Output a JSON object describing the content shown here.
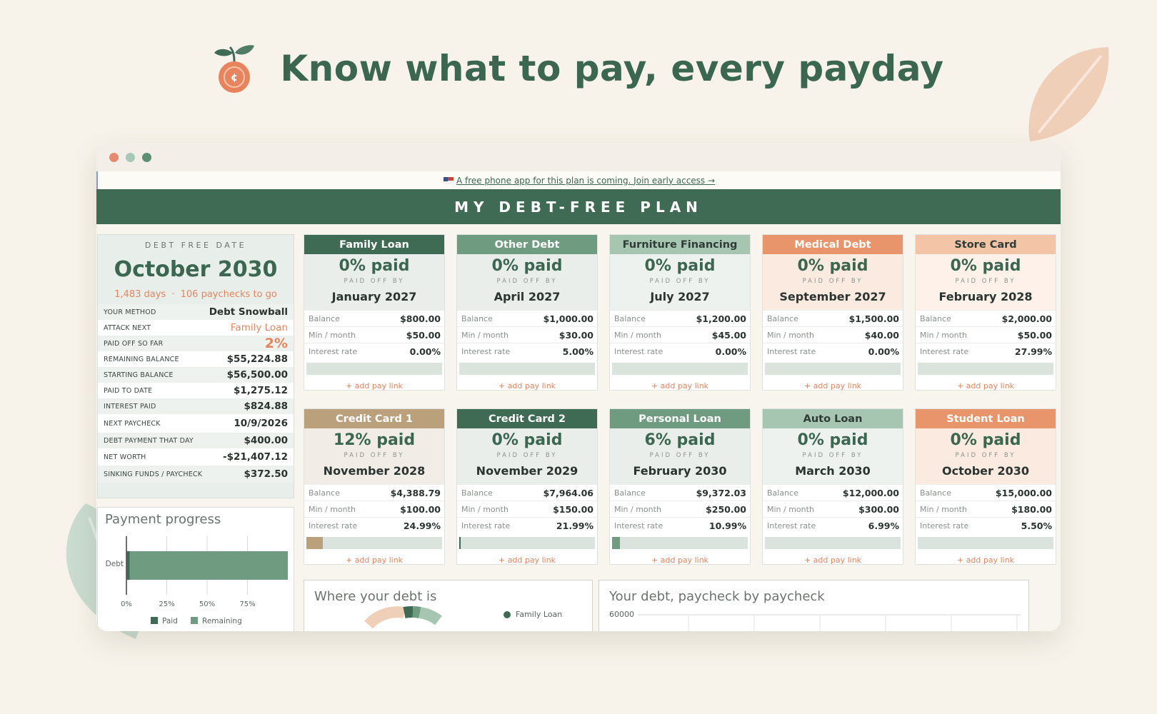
{
  "hero": {
    "title": "Know what to pay, every payday"
  },
  "banner": {
    "text": "A free phone app for this plan is coming. Join early access →"
  },
  "plan": {
    "title": "MY DEBT-FREE PLAN"
  },
  "summary": {
    "label": "DEBT FREE DATE",
    "date": "October 2030",
    "days": "1,483 days",
    "separator": "·",
    "paychecks": "106 paychecks to go",
    "rows": [
      {
        "key": "YOUR METHOD",
        "value": "Debt Snowball"
      },
      {
        "key": "ATTACK NEXT",
        "value": "Family Loan"
      },
      {
        "key": "PAID OFF SO FAR",
        "value": "2%"
      },
      {
        "key": "REMAINING BALANCE",
        "value": "$55,224.88"
      },
      {
        "key": "STARTING BALANCE",
        "value": "$56,500.00"
      },
      {
        "key": "PAID TO DATE",
        "value": "$1,275.12"
      },
      {
        "key": "INTEREST PAID",
        "value": "$824.88"
      },
      {
        "key": "NEXT PAYCHECK",
        "value": "10/9/2026"
      },
      {
        "key": "DEBT PAYMENT THAT DAY",
        "value": "$400.00"
      },
      {
        "key": "NET WORTH",
        "value": "-$21,407.12"
      },
      {
        "key": "SINKING FUNDS / PAYCHECK",
        "value": "$372.50"
      }
    ]
  },
  "labels": {
    "paid_off_by": "PAID OFF BY",
    "balance": "Balance",
    "min_month": "Min / month",
    "interest_rate": "Interest rate",
    "add_pay_link": "+ add pay link"
  },
  "debts": [
    {
      "name": "Family Loan",
      "paid": "0% paid",
      "paid_fraction": 0.0,
      "paid_off_by": "January 2027",
      "balance": "$800.00",
      "min": "$50.00",
      "rate": "0.00%",
      "color": "#3f6b55",
      "tint": "#e9eeea"
    },
    {
      "name": "Other Debt",
      "paid": "0% paid",
      "paid_fraction": 0.0,
      "paid_off_by": "April 2027",
      "balance": "$1,000.00",
      "min": "$30.00",
      "rate": "5.00%",
      "color": "#6f9b80",
      "tint": "#e9eeea"
    },
    {
      "name": "Furniture Financing",
      "paid": "0% paid",
      "paid_fraction": 0.0,
      "paid_off_by": "July 2027",
      "balance": "$1,200.00",
      "min": "$45.00",
      "rate": "0.00%",
      "color": "#a7c6b2",
      "tint": "#eef2ef"
    },
    {
      "name": "Medical Debt",
      "paid": "0% paid",
      "paid_fraction": 0.0,
      "paid_off_by": "September 2027",
      "balance": "$1,500.00",
      "min": "$40.00",
      "rate": "0.00%",
      "color": "#e8956c",
      "tint": "#fbeae0"
    },
    {
      "name": "Store Card",
      "paid": "0% paid",
      "paid_fraction": 0.0,
      "paid_off_by": "February 2028",
      "balance": "$2,000.00",
      "min": "$50.00",
      "rate": "27.99%",
      "color": "#f3c4a6",
      "tint": "#fdf1ea"
    },
    {
      "name": "Credit Card 1",
      "paid": "12% paid",
      "paid_fraction": 0.12,
      "paid_off_by": "November 2028",
      "balance": "$4,388.79",
      "min": "$100.00",
      "rate": "24.99%",
      "color": "#bba07c",
      "tint": "#f1ede6"
    },
    {
      "name": "Credit Card 2",
      "paid": "0% paid",
      "paid_fraction": 0.005,
      "paid_off_by": "November 2029",
      "balance": "$7,964.06",
      "min": "$150.00",
      "rate": "21.99%",
      "color": "#3f6b55",
      "tint": "#e9eeea"
    },
    {
      "name": "Personal Loan",
      "paid": "6% paid",
      "paid_fraction": 0.06,
      "paid_off_by": "February 2030",
      "balance": "$9,372.03",
      "min": "$250.00",
      "rate": "10.99%",
      "color": "#6f9b80",
      "tint": "#e9eeea"
    },
    {
      "name": "Auto Loan",
      "paid": "0% paid",
      "paid_fraction": 0.0,
      "paid_off_by": "March 2030",
      "balance": "$12,000.00",
      "min": "$300.00",
      "rate": "6.99%",
      "color": "#a7c6b2",
      "tint": "#eef2ef"
    },
    {
      "name": "Student Loan",
      "paid": "0% paid",
      "paid_fraction": 0.0,
      "paid_off_by": "October 2030",
      "balance": "$15,000.00",
      "min": "$180.00",
      "rate": "5.50%",
      "color": "#e8956c",
      "tint": "#fbeae0"
    }
  ],
  "progress_chart": {
    "title": "Payment progress",
    "chart_data": {
      "type": "bar",
      "orientation": "horizontal",
      "stacked": true,
      "categories": [
        "Debt"
      ],
      "series": [
        {
          "name": "Paid",
          "values": [
            2
          ],
          "color": "#3f6b55"
        },
        {
          "name": "Remaining",
          "values": [
            98
          ],
          "color": "#6f9b80"
        }
      ],
      "x_ticks": [
        "0%",
        "25%",
        "50%",
        "75%"
      ],
      "xlim": [
        0,
        100
      ],
      "grid": true,
      "legend": "bottom"
    }
  },
  "donut_chart": {
    "title": "Where your debt is",
    "legend_first": "Family Loan"
  },
  "line_chart": {
    "title": "Your debt, paycheck by paycheck",
    "y_top_tick": "60000"
  },
  "colors": {
    "brand_green": "#3f6b55",
    "accent_orange": "#e8845d",
    "background": "#f7f3ea"
  }
}
